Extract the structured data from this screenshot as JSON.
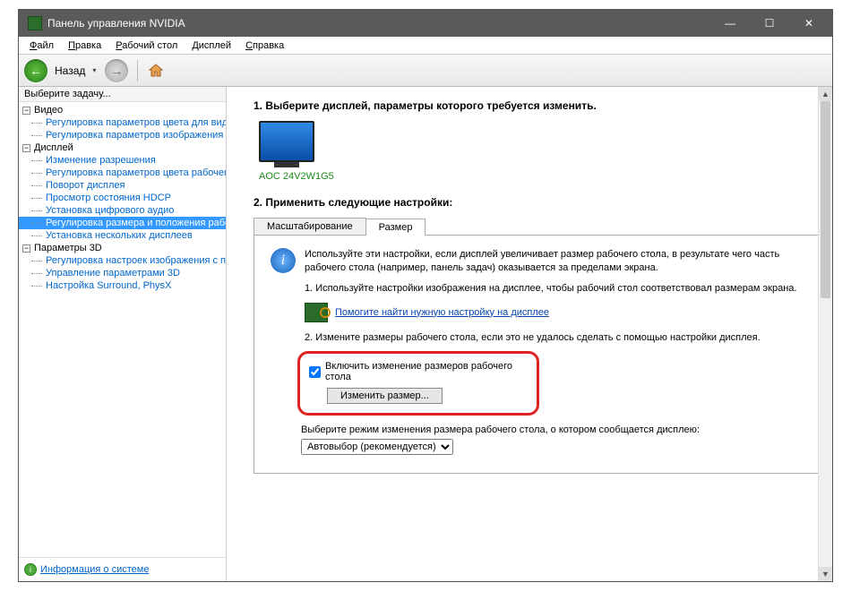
{
  "window": {
    "title": "Панель управления NVIDIA"
  },
  "winbuttons": {
    "min": "—",
    "max": "☐",
    "close": "✕"
  },
  "menu": {
    "file": "Файл",
    "edit": "Правка",
    "desktop": "Рабочий стол",
    "display": "Дисплей",
    "help": "Справка"
  },
  "toolbar": {
    "back_arrow": "←",
    "back_label": "Назад",
    "dd": "▾",
    "fwd_arrow": "→"
  },
  "sidebar": {
    "header": "Выберите задачу...",
    "cat_video": "Видео",
    "video": {
      "color": "Регулировка параметров цвета для вид",
      "image": "Регулировка параметров изображения д"
    },
    "cat_display": "Дисплей",
    "display": {
      "resolution": "Изменение разрешения",
      "desktop_color": "Регулировка параметров цвета рабочег",
      "rotate": "Поворот дисплея",
      "hdcp": "Просмотр состояния HDCP",
      "audio": "Установка цифрового аудио",
      "resize": "Регулировка размера и положения рабо",
      "multi": "Установка нескольких дисплеев"
    },
    "cat_3d": "Параметры 3D",
    "p3d": {
      "image": "Регулировка настроек изображения с пр",
      "manage": "Управление параметрами 3D",
      "surround": "Настройка Surround, PhysX"
    },
    "sysinfo": "Информация о системе"
  },
  "content": {
    "step1": "1. Выберите дисплей, параметры которого требуется изменить.",
    "monitor_name": "AOC 24V2W1G5",
    "step2": "2. Применить следующие настройки:",
    "tab_scale": "Масштабирование",
    "tab_size": "Размер",
    "info_text": "Используйте эти настройки, если дисплей увеличивает размер рабочего стола, в результате чего часть рабочего стола (например, панель задач) оказывается за пределами экрана.",
    "substep1": "1. Используйте настройки изображения на дисплее, чтобы рабочий стол соответствовал размерам экрана.",
    "help_link": "Помогите найти нужную настройку на дисплее",
    "substep2": "2. Измените размеры рабочего стола, если это не удалось сделать с помощью настройки дисплея.",
    "checkbox_label": "Включить изменение размеров рабочего стола",
    "resize_button": "Изменить размер...",
    "mode_label": "Выберите режим изменения размера рабочего стола, о котором сообщается дисплею:",
    "mode_value": "Автовыбор (рекомендуется)"
  }
}
